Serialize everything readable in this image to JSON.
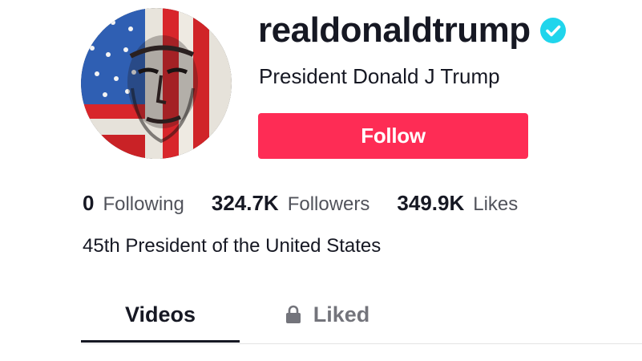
{
  "profile": {
    "username": "realdonaldtrump",
    "display_name": "President Donald J Trump",
    "verified_icon": "verified-badge-icon",
    "bio": "45th President of the United States"
  },
  "actions": {
    "follow_label": "Follow"
  },
  "stats": {
    "following_count": "0",
    "following_label": "Following",
    "followers_count": "324.7K",
    "followers_label": "Followers",
    "likes_count": "349.9K",
    "likes_label": "Likes"
  },
  "tabs": [
    {
      "label": "Videos",
      "active": true
    },
    {
      "label": "Liked",
      "active": false,
      "icon": "lock-icon"
    }
  ],
  "colors": {
    "follow_button": "#fe2c55",
    "verified_badge": "#20d5ec",
    "text_primary": "#161823"
  }
}
